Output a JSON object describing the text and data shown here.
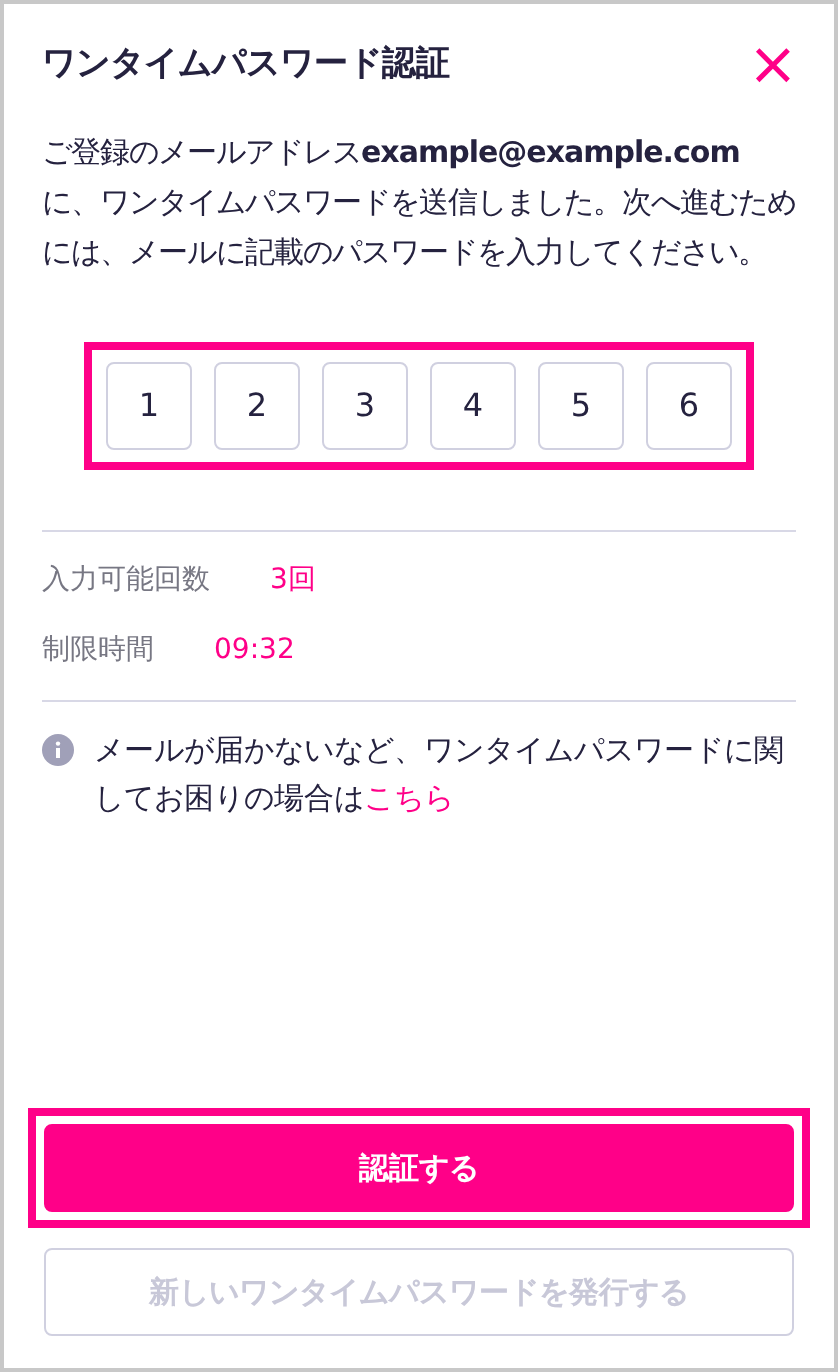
{
  "dialog": {
    "title": "ワンタイムパスワード認証",
    "close": "×"
  },
  "message": "ご登録のメールアドレス**example@example.com**に、ワンタイムパスワードを送信しました。次へ進むためには、メールに記載のパスワードを入力してください。",
  "otp": {
    "highlighted": true,
    "digits": [
      "1",
      "2",
      "3",
      "4",
      "5",
      "6"
    ]
  },
  "info_rows": [
    {
      "label": "入力可能回数",
      "value": "3回"
    },
    {
      "label": "制限時間",
      "value": "09:32"
    }
  ],
  "help": {
    "text": "メールが届かないなど、ワンタイムパスワードに関してお困りの場合は",
    "link": "こちら"
  },
  "buttons": [
    {
      "label": "認証する",
      "kind": "primary",
      "highlighted": true,
      "disabled": false
    },
    {
      "label": "新しいワンタイムパスワードを発行する",
      "kind": "secondary",
      "highlighted": false,
      "disabled": true
    }
  ]
}
